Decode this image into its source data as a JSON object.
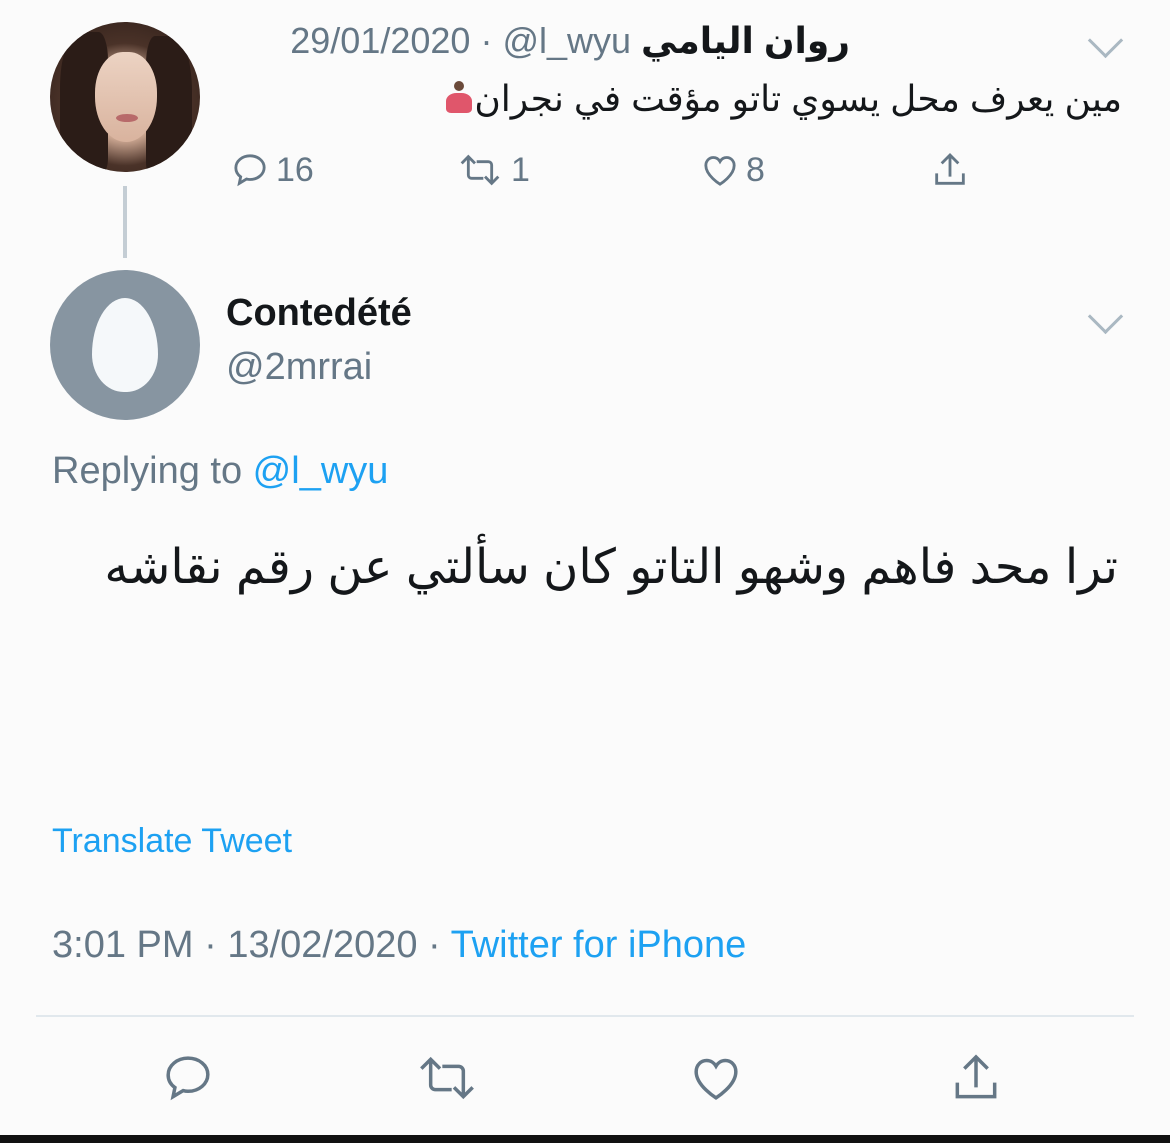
{
  "parent_tweet": {
    "name": "روان اليامي",
    "handle": "@l_wyu",
    "separator": " · ",
    "date": "29/01/2020",
    "text": "مين يعرف محل يسوي تاتو مؤقت في نجران",
    "emoji": "person-in-lotus-position",
    "reply_count": "16",
    "retweet_count": "1",
    "like_count": "8"
  },
  "reply_tweet": {
    "name": "Contedété",
    "handle": "@2mrrai",
    "replying_label": "Replying to ",
    "replying_to": "@l_wyu",
    "text": "ترا محد فاهم وشهو التاتو كان سألتي عن رقم نقاشه",
    "translate_label": "Translate Tweet",
    "time": "3:01 PM",
    "separator": " · ",
    "date": "13/02/2020",
    "separator2": " · ",
    "source": "Twitter for iPhone"
  },
  "colors": {
    "link": "#1da1f2",
    "secondary": "#657786",
    "primary": "#14171a"
  },
  "icons": {
    "reply": "reply-icon",
    "retweet": "retweet-icon",
    "like": "heart-icon",
    "share": "share-icon",
    "more": "chevron-down-icon"
  }
}
